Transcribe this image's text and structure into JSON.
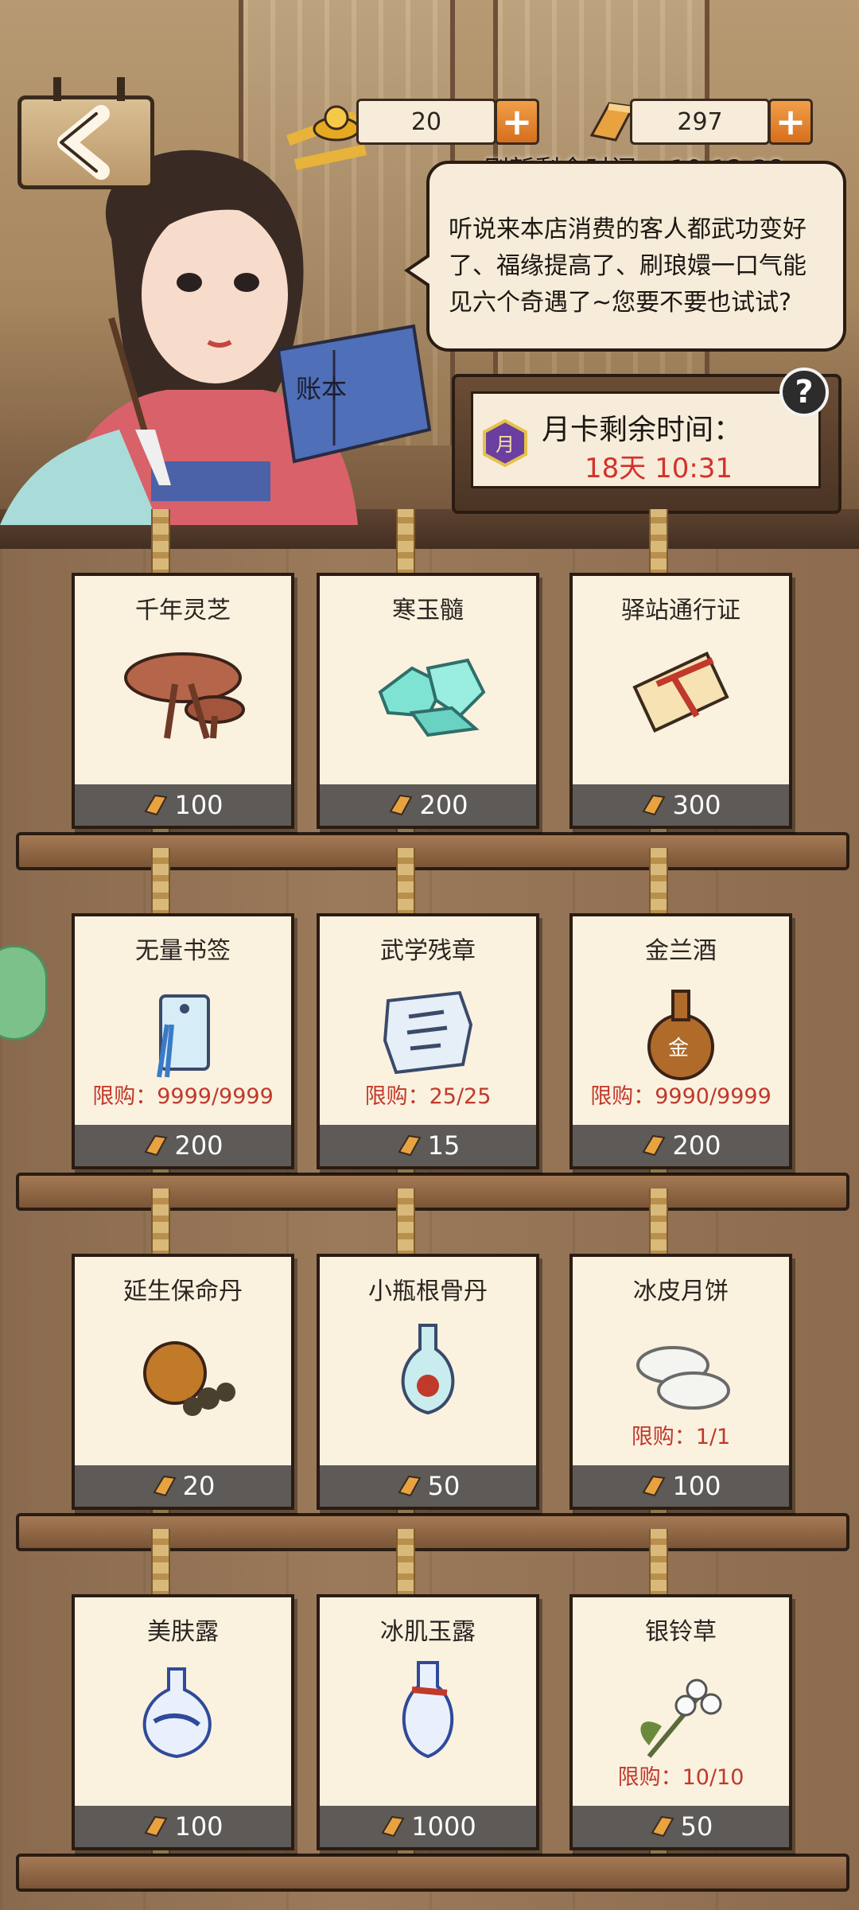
{
  "header": {
    "gold_ingot_count": "20",
    "silver_bar_count": "297",
    "refresh_timer": "刷新剩余时间：  10:12:38"
  },
  "dialogue": {
    "text": "听说来本店消费的客人都武功变好了、福缘提高了、刷琅嬛一口气能见六个奇遇了~您要不要也试试?"
  },
  "account_book": {
    "label": "账本"
  },
  "monthly_card": {
    "label": "月卡剩余时间：",
    "remaining": "18天 10:31",
    "help_icon": "?"
  },
  "shelves": [
    {
      "items": [
        {
          "name": "千年灵芝",
          "price": "100",
          "limit": "",
          "icon": "lingzhi-icon"
        },
        {
          "name": "寒玉髓",
          "price": "200",
          "limit": "",
          "icon": "jade-crystal-icon"
        },
        {
          "name": "驿站通行证",
          "price": "300",
          "limit": "",
          "icon": "scroll-icon"
        }
      ]
    },
    {
      "items": [
        {
          "name": "无量书签",
          "price": "200",
          "limit": "限购：9999/9999",
          "icon": "bookmark-icon"
        },
        {
          "name": "武学残章",
          "price": "15",
          "limit": "限购：25/25",
          "icon": "torn-page-icon"
        },
        {
          "name": "金兰酒",
          "price": "200",
          "limit": "限购：9990/9999",
          "icon": "wine-gourd-icon"
        }
      ]
    },
    {
      "items": [
        {
          "name": "延生保命丹",
          "price": "20",
          "limit": "",
          "icon": "pill-pouch-icon"
        },
        {
          "name": "小瓶根骨丹",
          "price": "50",
          "limit": "",
          "icon": "small-bottle-icon"
        },
        {
          "name": "冰皮月饼",
          "price": "100",
          "limit": "限购：1/1",
          "icon": "mooncake-icon"
        }
      ]
    },
    {
      "items": [
        {
          "name": "美肤露",
          "price": "100",
          "limit": "",
          "icon": "porcelain-vase-icon"
        },
        {
          "name": "冰肌玉露",
          "price": "1000",
          "limit": "",
          "icon": "tall-vase-icon"
        },
        {
          "name": "银铃草",
          "price": "50",
          "limit": "限购：10/10",
          "icon": "lily-flower-icon"
        }
      ]
    }
  ],
  "colors": {
    "limit_red": "#c0392b",
    "price_bar": "#5d5a58",
    "plus_orange": "#e8852e",
    "card_bg": "#faf1df"
  }
}
